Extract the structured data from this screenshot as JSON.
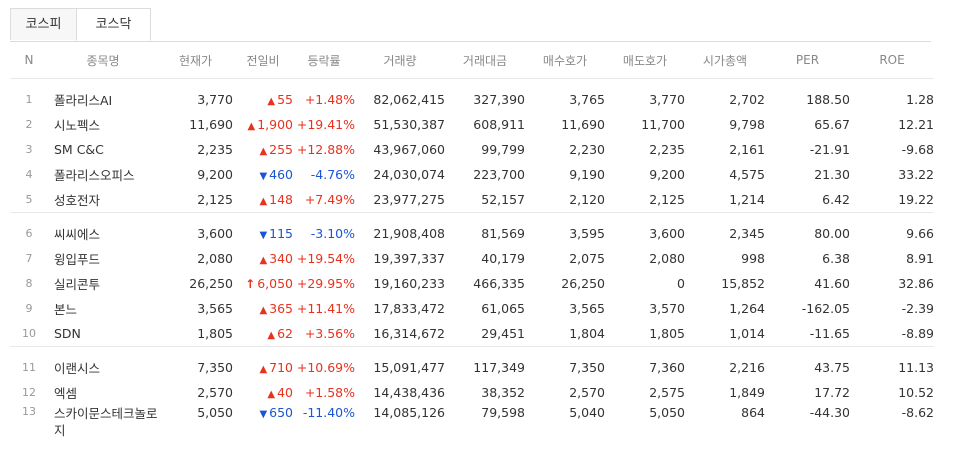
{
  "tabs": [
    {
      "label": "코스피",
      "active": false
    },
    {
      "label": "코스닥",
      "active": true
    }
  ],
  "columns": [
    "N",
    "종목명",
    "현재가",
    "전일비",
    "등락률",
    "거래량",
    "거래대금",
    "매수호가",
    "매도호가",
    "시가총액",
    "PER",
    "ROE"
  ],
  "colors": {
    "up": "#e8321e",
    "down": "#1a55d6"
  },
  "groups": [
    [
      {
        "n": "1",
        "name": "폴라리스AI",
        "price": "3,770",
        "dir": "up",
        "change": "55",
        "rate": "+1.48%",
        "volume": "82,062,415",
        "amount": "327,390",
        "bid": "3,765",
        "ask": "3,770",
        "cap": "2,702",
        "per": "188.50",
        "roe": "1.28"
      },
      {
        "n": "2",
        "name": "시노펙스",
        "price": "11,690",
        "dir": "up",
        "change": "1,900",
        "rate": "+19.41%",
        "volume": "51,530,387",
        "amount": "608,911",
        "bid": "11,690",
        "ask": "11,700",
        "cap": "9,798",
        "per": "65.67",
        "roe": "12.21"
      },
      {
        "n": "3",
        "name": "SM C&C",
        "price": "2,235",
        "dir": "up",
        "change": "255",
        "rate": "+12.88%",
        "volume": "43,967,060",
        "amount": "99,799",
        "bid": "2,230",
        "ask": "2,235",
        "cap": "2,161",
        "per": "-21.91",
        "roe": "-9.68"
      },
      {
        "n": "4",
        "name": "폴라리스오피스",
        "price": "9,200",
        "dir": "down",
        "change": "460",
        "rate": "-4.76%",
        "volume": "24,030,074",
        "amount": "223,700",
        "bid": "9,190",
        "ask": "9,200",
        "cap": "4,575",
        "per": "21.30",
        "roe": "33.22"
      },
      {
        "n": "5",
        "name": "성호전자",
        "price": "2,125",
        "dir": "up",
        "change": "148",
        "rate": "+7.49%",
        "volume": "23,977,275",
        "amount": "52,157",
        "bid": "2,120",
        "ask": "2,125",
        "cap": "1,214",
        "per": "6.42",
        "roe": "19.22"
      }
    ],
    [
      {
        "n": "6",
        "name": "씨씨에스",
        "price": "3,600",
        "dir": "down",
        "change": "115",
        "rate": "-3.10%",
        "volume": "21,908,408",
        "amount": "81,569",
        "bid": "3,595",
        "ask": "3,600",
        "cap": "2,345",
        "per": "80.00",
        "roe": "9.66"
      },
      {
        "n": "7",
        "name": "윙입푸드",
        "price": "2,080",
        "dir": "up",
        "change": "340",
        "rate": "+19.54%",
        "volume": "19,397,337",
        "amount": "40,179",
        "bid": "2,075",
        "ask": "2,080",
        "cap": "998",
        "per": "6.38",
        "roe": "8.91"
      },
      {
        "n": "8",
        "name": "실리콘투",
        "price": "26,250",
        "dir": "upper",
        "change": "6,050",
        "rate": "+29.95%",
        "volume": "19,160,233",
        "amount": "466,335",
        "bid": "26,250",
        "ask": "0",
        "cap": "15,852",
        "per": "41.60",
        "roe": "32.86"
      },
      {
        "n": "9",
        "name": "본느",
        "price": "3,565",
        "dir": "up",
        "change": "365",
        "rate": "+11.41%",
        "volume": "17,833,472",
        "amount": "61,065",
        "bid": "3,565",
        "ask": "3,570",
        "cap": "1,264",
        "per": "-162.05",
        "roe": "-2.39"
      },
      {
        "n": "10",
        "name": "SDN",
        "price": "1,805",
        "dir": "up",
        "change": "62",
        "rate": "+3.56%",
        "volume": "16,314,672",
        "amount": "29,451",
        "bid": "1,804",
        "ask": "1,805",
        "cap": "1,014",
        "per": "-11.65",
        "roe": "-8.89"
      }
    ],
    [
      {
        "n": "11",
        "name": "이랜시스",
        "price": "7,350",
        "dir": "up",
        "change": "710",
        "rate": "+10.69%",
        "volume": "15,091,477",
        "amount": "117,349",
        "bid": "7,350",
        "ask": "7,360",
        "cap": "2,216",
        "per": "43.75",
        "roe": "11.13"
      },
      {
        "n": "12",
        "name": "엑셈",
        "price": "2,570",
        "dir": "up",
        "change": "40",
        "rate": "+1.58%",
        "volume": "14,438,436",
        "amount": "38,352",
        "bid": "2,570",
        "ask": "2,575",
        "cap": "1,849",
        "per": "17.72",
        "roe": "10.52"
      },
      {
        "n": "13",
        "name": "스카이문스테크놀로지",
        "price": "5,050",
        "dir": "down",
        "change": "650",
        "rate": "-11.40%",
        "volume": "14,085,126",
        "amount": "79,598",
        "bid": "5,040",
        "ask": "5,050",
        "cap": "864",
        "per": "-44.30",
        "roe": "-8.62"
      }
    ]
  ]
}
